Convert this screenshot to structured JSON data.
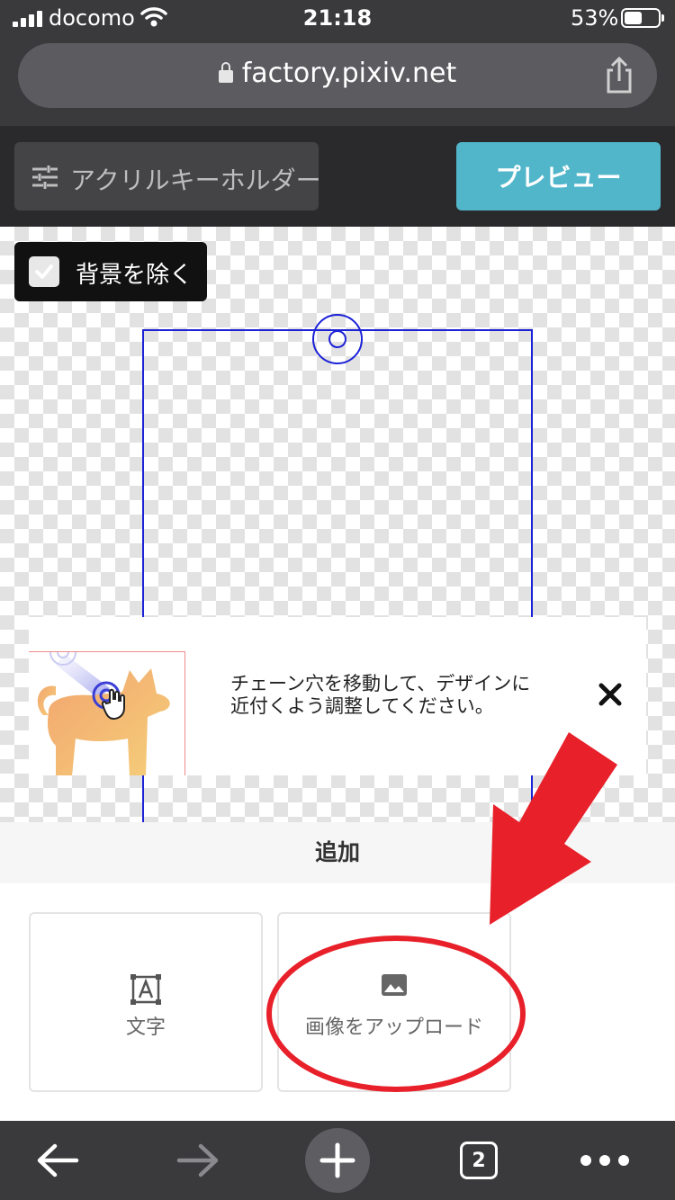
{
  "status_bar": {
    "carrier": "docomo",
    "time": "21:18",
    "battery_percent": "53%",
    "battery_level": 0.53
  },
  "browser": {
    "url": "factory.pixiv.net",
    "tab_count": "2"
  },
  "toolbar": {
    "product_label": "アクリルキーホルダー",
    "preview_label": "プレビュー"
  },
  "canvas": {
    "remove_bg_label": "背景を除く",
    "remove_bg_checked": true,
    "frame_color": "#1c22d6"
  },
  "tip": {
    "text": "チェーン穴を移動して、デザインに\n近付くよう調整してください。"
  },
  "add_panel": {
    "title": "追加",
    "options": [
      {
        "label": "文字",
        "icon": "text-box-icon"
      },
      {
        "label": "画像をアップロード",
        "icon": "image-icon"
      }
    ]
  },
  "annotation": {
    "color": "#e8202a"
  },
  "colors": {
    "accent": "#52b6cb",
    "chrome": "#3a3a3c",
    "toolbar": "#2a2a2c"
  }
}
